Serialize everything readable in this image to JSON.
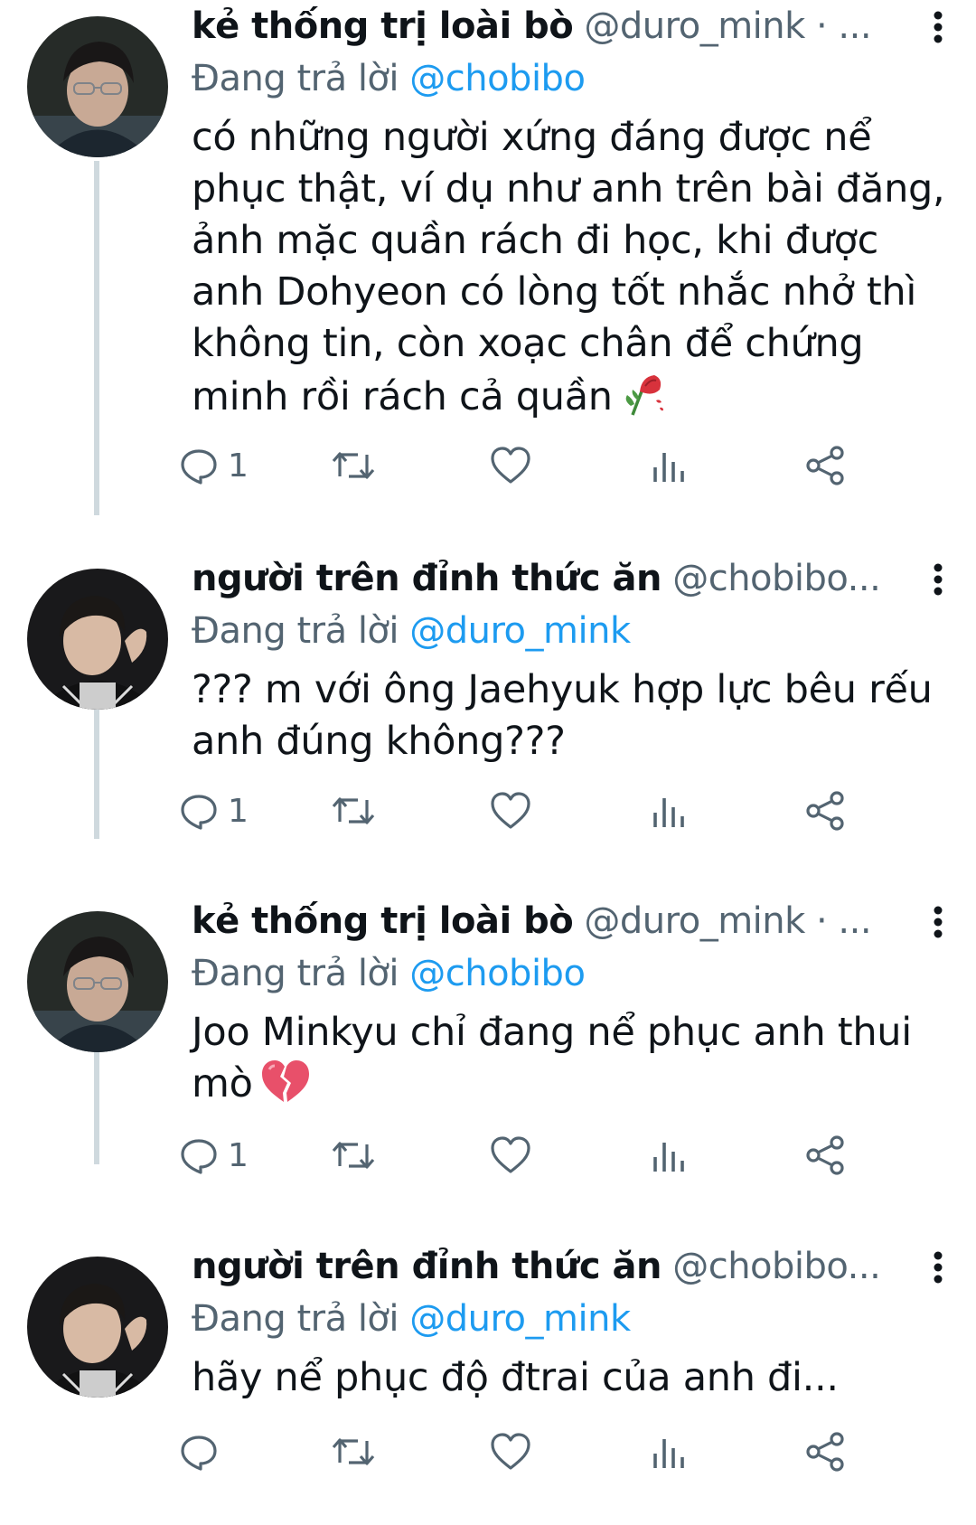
{
  "colors": {
    "text": "#0f1419",
    "muted": "#536471",
    "link": "#1d9bf0",
    "thread_line": "#cfd9de"
  },
  "tweets": [
    {
      "display_name": "kẻ thống trị loài bò",
      "handle": "@duro_mink · ...",
      "reply_prefix": "Đang trả lời ",
      "reply_to": "@chobibo",
      "text": "có những người xứng đáng được nể\nphục thật, ví dụ như anh trên bài đăng,\nảnh mặc quần rách đi học, khi được\nanh Dohyeon có lòng tốt nhắc nhở thì\nkhông tin, còn xoạc chân để chứng\nminh rồi rách cả quần",
      "emoji": "wilted-rose-icon",
      "reply_count": "1"
    },
    {
      "display_name": "người trên đỉnh thức ăn",
      "handle": "@chobibo...",
      "reply_prefix": "Đang trả lời ",
      "reply_to": "@duro_mink",
      "text": "??? m với ông Jaehyuk hợp lực bêu rếu\nanh đúng không???",
      "emoji": "",
      "reply_count": "1"
    },
    {
      "display_name": "kẻ thống trị loài bò",
      "handle": "@duro_mink · ...",
      "reply_prefix": "Đang trả lời ",
      "reply_to": "@chobibo",
      "text": "Joo Minkyu chỉ đang nể phục anh thui\nmò",
      "emoji": "broken-heart-icon",
      "reply_count": "1"
    },
    {
      "display_name": "người trên đỉnh thức ăn",
      "handle": "@chobibo...",
      "reply_prefix": "Đang trả lời ",
      "reply_to": "@duro_mink",
      "text": "hãy nể phục độ đtrai của anh đi...",
      "emoji": "",
      "reply_count": ""
    }
  ],
  "action_icons": [
    "reply-icon",
    "retweet-icon",
    "like-icon",
    "views-icon",
    "share-icon"
  ]
}
